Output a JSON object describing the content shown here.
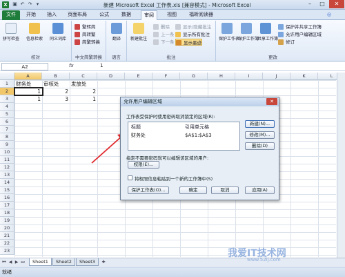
{
  "titlebar": {
    "app_icon": "X",
    "title": "新建 Microsoft Excel 工作表.xls [兼容模式] - Microsoft Excel",
    "save_icon": "save-icon",
    "undo_icon": "undo-icon",
    "redo_icon": "redo-icon"
  },
  "tabs": [
    "文件",
    "开始",
    "插入",
    "页面布局",
    "公式",
    "数据",
    "审阅",
    "视图",
    "福昕阅读器"
  ],
  "ribbon": {
    "proofing": {
      "label": "校对",
      "spellcheck": "拼写检查",
      "research": "信息检索",
      "thesaurus": "同义词库"
    },
    "chinese": {
      "label": "中文简繁转换",
      "to_simplified": "繁转简",
      "to_traditional": "简转繁",
      "convert": "简繁转换"
    },
    "language": {
      "label": "语言",
      "translate": "翻译"
    },
    "comments": {
      "label": "批注",
      "new_comment": "新建批注",
      "delete": "删除",
      "previous": "上一条",
      "next": "下一条",
      "show_hide": "显示/隐藏批注",
      "show_all": "显示所有批注",
      "show_ink": "显示墨迹"
    },
    "changes": {
      "label": "更改",
      "protect_sheet": "保护工作表",
      "protect_workbook": "保护工作簿",
      "share_workbook": "共享工作簿",
      "protect_share": "保护并共享工作簿",
      "allow_edit_ranges": "允许用户编辑区域",
      "track_changes": "修订"
    }
  },
  "formula_bar": {
    "name_box": "A2",
    "fx": "fx",
    "value": "1"
  },
  "columns": [
    "A",
    "B",
    "C",
    "D",
    "E",
    "F",
    "G",
    "H",
    "I",
    "J",
    "K",
    "L"
  ],
  "rows": [
    "1",
    "2",
    "3",
    "4",
    "5",
    "6",
    "7",
    "8",
    "9",
    "10",
    "11",
    "12",
    "13",
    "14",
    "15",
    "16",
    "17",
    "18",
    "19",
    "20",
    "21",
    "22",
    "23"
  ],
  "cells": {
    "a1": "财务处",
    "b1": "审核处",
    "c1": "发放处",
    "a2": "1",
    "b2": "2",
    "c2": "2",
    "a3": "1",
    "b3": "3",
    "c3": "1"
  },
  "sheets": [
    "Sheet1",
    "Sheet2",
    "Sheet3"
  ],
  "status": "就绪",
  "dialog": {
    "title": "允许用户编辑区域",
    "ranges_label": "工作表受保护时使用密码取消锁定的区域(R):",
    "col_title": "标题",
    "col_ref": "引用单元格",
    "row_title": "财务处",
    "row_ref": "$A$1:$A$3",
    "new_btn": "新建(N)...",
    "modify_btn": "修改(M)...",
    "delete_btn": "删除(D)",
    "no_password_label": "指定不需要密码就可以编辑该区域的用户:",
    "permissions_btn": "权限(E)...",
    "paste_checkbox": "将权限信息粘贴到一个新的工作簿中(S)",
    "protect_btn": "保护工作表(O)...",
    "ok_btn": "确定",
    "cancel_btn": "取消",
    "apply_btn": "应用(A)"
  },
  "watermark": {
    "main": "我爱IT技术网",
    "sub": "www.52ij.com"
  },
  "colors": {
    "file_tab": "#1f7d3b",
    "arrow": "#e0272c",
    "selection": "#222222"
  }
}
